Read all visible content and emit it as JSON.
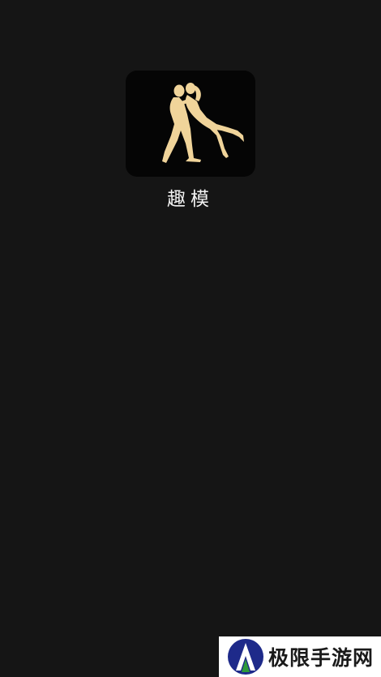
{
  "app": {
    "name": "趣模",
    "icon": "dancing-couple-icon",
    "icon_bg": "#050505",
    "icon_fg": "#f0d49a"
  },
  "background": "#151515",
  "watermark": {
    "text": "极限手游网",
    "logo": "watermark-logo-icon",
    "logo_colors": [
      "#1e2a8a",
      "#2e9a3a"
    ]
  }
}
